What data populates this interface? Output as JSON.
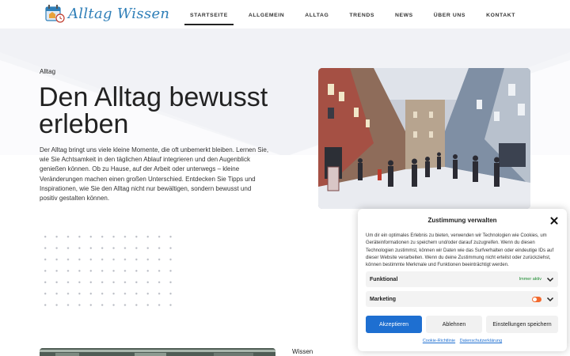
{
  "site": {
    "name": "Alltag Wissen",
    "logo_icon": "calendar-house-icon"
  },
  "nav": {
    "items": [
      {
        "label": "STARTSEITE",
        "active": true
      },
      {
        "label": "ALLGEMEIN",
        "active": false
      },
      {
        "label": "ALLTAG",
        "active": false
      },
      {
        "label": "TRENDS",
        "active": false
      },
      {
        "label": "NEWS",
        "active": false
      },
      {
        "label": "ÜBER UNS",
        "active": false
      },
      {
        "label": "KONTAKT",
        "active": false
      }
    ]
  },
  "hero": {
    "eyebrow": "Alltag",
    "title": "Den Alltag bewusst erleben",
    "text": "Der Alltag bringt uns viele kleine Momente, die oft unbemerkt bleiben. Lernen Sie, wie Sie Achtsamkeit in den täglichen Ablauf integrieren und den Augenblick genießen können. Ob zu Hause, auf der Arbeit oder unterwegs – kleine Veränderungen machen einen großen Unterschied. Entdecken Sie Tipps und Inspirationen, wie Sie den Alltag nicht nur bewältigen, sondern bewusst und positiv gestalten können."
  },
  "next_section": {
    "label": "Wissen"
  },
  "consent": {
    "title": "Zustimmung verwalten",
    "body": "Um dir ein optimales Erlebnis zu bieten, verwenden wir Technologien wie Cookies, um Geräteinformationen zu speichern und/oder darauf zuzugreifen. Wenn du diesen Technologien zustimmst, können wir Daten wie das Surfverhalten oder eindeutige IDs auf dieser Website verarbeiten. Wenn du deine Zustimmung nicht erteilst oder zurückziehst, können bestimmte Merkmale und Funktionen beeinträchtigt werden.",
    "rows": [
      {
        "label": "Funktional",
        "status": "Immer aktiv"
      },
      {
        "label": "Marketing",
        "status": ""
      }
    ],
    "accept_label": "Akzeptieren",
    "decline_label": "Ablehnen",
    "settings_label": "Einstellungen speichern",
    "link_cookie": "Cookie-Richtlinie",
    "link_privacy": "Datenschutzerklärung",
    "colors": {
      "accept": "#1e6fd1",
      "status_active": "#1a8a2e",
      "toggle_marketing": "#f26a2e"
    }
  },
  "colors": {
    "logo_text": "#2f7fb8",
    "hero_bg": "#f4f5f8"
  }
}
